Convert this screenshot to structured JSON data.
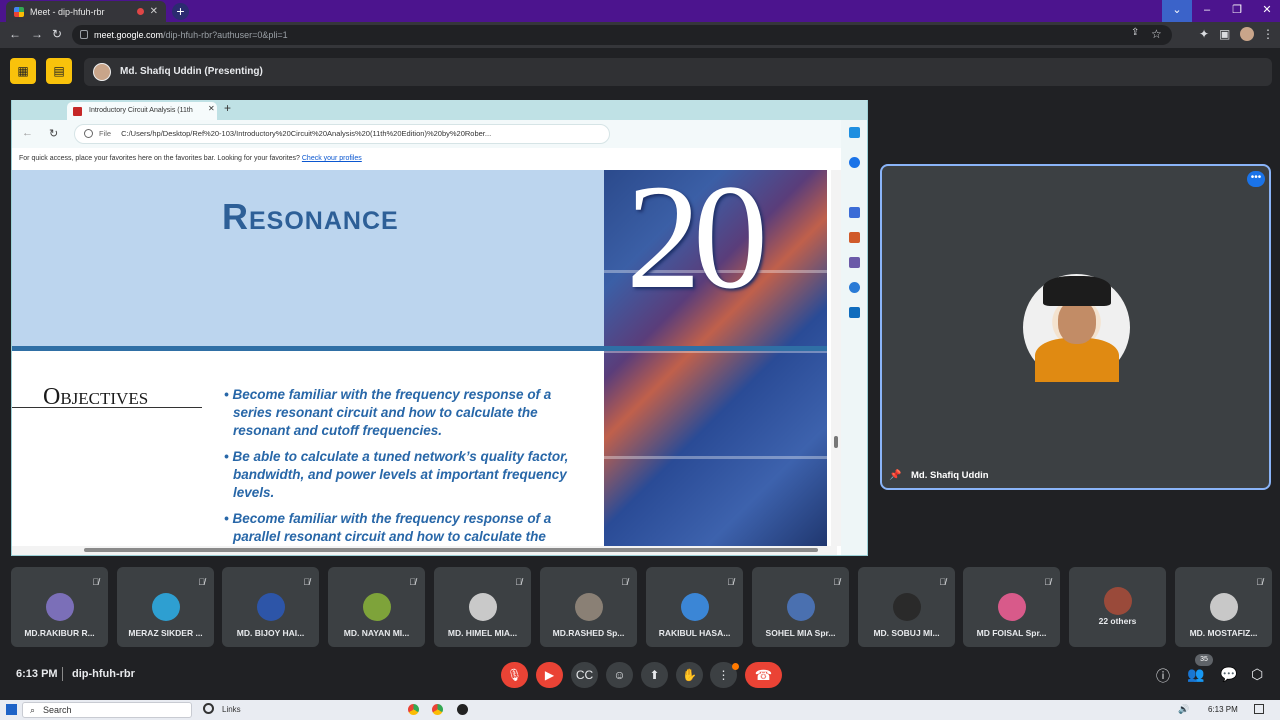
{
  "browser": {
    "tab_title": "Meet - dip-hfuh-rbr",
    "url_host": "meet.google.com",
    "url_path": "/dip-hfuh-rbr?authuser=0&pli=1"
  },
  "meeting": {
    "presenter_label": "Md. Shafiq Uddin (Presenting)",
    "speaker_name": "Md. Shafiq Uddin",
    "time": "6:13 PM",
    "code": "dip-hfuh-rbr",
    "participant_count": "35"
  },
  "shared_screen": {
    "tab_title": "Introductory Circuit Analysis (11th",
    "file_label": "File",
    "url": "C:/Users/hp/Desktop/Ref%20-103/Introductory%20Circuit%20Analysis%20(11th%20Edition)%20by%20Rober...",
    "favbar_text": "For quick access, place your favorites here on the favorites bar. Looking for your favorites?",
    "favbar_link": "Check your profiles",
    "chapter_number": "20",
    "chapter_title": "Resonance",
    "objectives_title": "Objectives",
    "objectives": [
      "• Become familiar with the frequency response of a series resonant circuit and how to calculate the resonant and cutoff frequencies.",
      "• Be able to calculate a tuned network’s quality factor, bandwidth, and power levels at important frequency levels.",
      "• Become familiar with the frequency response of a parallel resonant circuit and how to calculate the"
    ]
  },
  "participants": [
    {
      "name": "MD.RAKIBUR R...",
      "color": "#7b6fb8"
    },
    {
      "name": "MERAZ SIKDER ...",
      "color": "#2e9fd1"
    },
    {
      "name": "MD. BIJOY HAI...",
      "color": "#2d55a8"
    },
    {
      "name": "MD. NAYAN MI...",
      "color": "#7ea33a"
    },
    {
      "name": "MD. HIMEL MIA...",
      "color": "#c9c9c9"
    },
    {
      "name": "MD.RASHED Sp...",
      "color": "#8a8075"
    },
    {
      "name": "RAKIBUL HASA...",
      "color": "#3b86d6"
    },
    {
      "name": "SOHEL MIA Spr...",
      "color": "#4a70b0"
    },
    {
      "name": "MD. SOBUJ MI...",
      "color": "#2a2a2a"
    },
    {
      "name": "MD FOISAL Spr...",
      "color": "#d85a8a"
    },
    {
      "name": "22 others",
      "color": "#9a4a3a"
    },
    {
      "name": "MD. MOSTAFIZ...",
      "color": "#c8c8c8"
    }
  ],
  "taskbar": {
    "search": "Search",
    "links": "Links",
    "time": "6:13 PM"
  }
}
